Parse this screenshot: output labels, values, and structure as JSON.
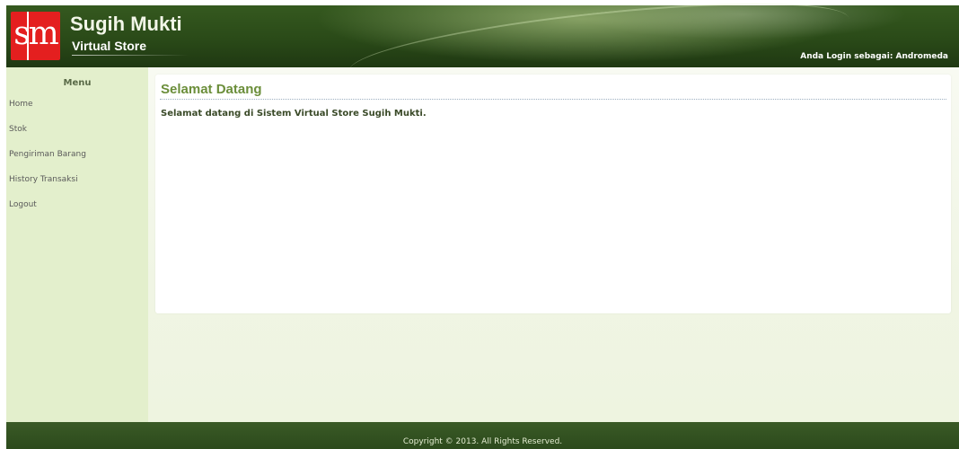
{
  "header": {
    "logo_text": "sm",
    "brand_title": "Sugih Mukti",
    "brand_subtitle": "Virtual Store",
    "login_info": "Anda Login sebagai: Andromeda"
  },
  "sidebar": {
    "title": "Menu",
    "items": [
      {
        "label": "Home"
      },
      {
        "label": "Stok"
      },
      {
        "label": "Pengiriman Barang"
      },
      {
        "label": "History Transaksi"
      },
      {
        "label": "Logout"
      }
    ]
  },
  "main": {
    "title": "Selamat Datang",
    "message": "Selamat datang di Sistem Virtual Store Sugih Mukti."
  },
  "footer": {
    "copyright": "Copyright © 2013. All Rights Reserved."
  },
  "colors": {
    "header_green": "#2a4a18",
    "logo_red": "#e41f1f",
    "sidebar_bg": "#e3efcc",
    "title_green": "#6b8e3a"
  }
}
